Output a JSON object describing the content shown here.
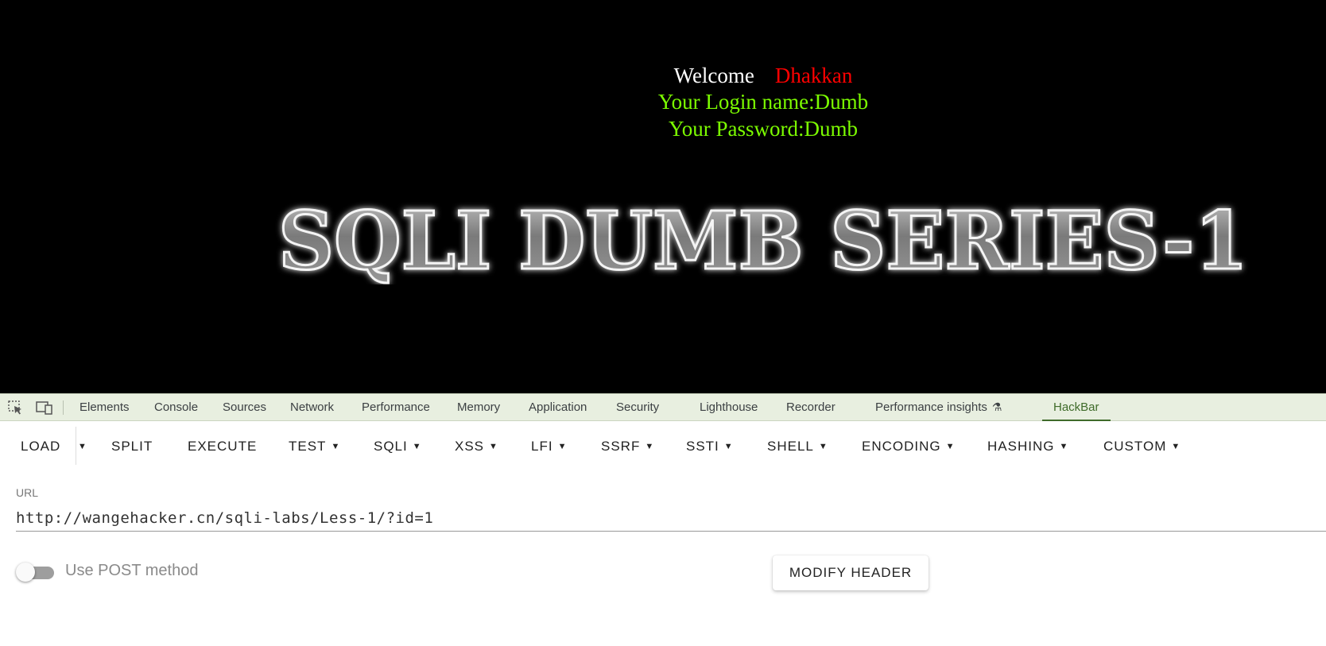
{
  "page": {
    "welcome_word": "Welcome",
    "welcome_user": "Dhakkan",
    "login_line": "Your Login name:Dumb",
    "password_line": "Your Password:Dumb",
    "banner_text": "SQLI DUMB SERIES-1",
    "colors": {
      "background": "#000000",
      "welcome": "#ffffff",
      "user": "#ff0000",
      "info": "#7cfc00"
    }
  },
  "devtools": {
    "icons": [
      "inspect-element-icon",
      "device-toolbar-icon"
    ],
    "tabs": [
      {
        "label": "Elements"
      },
      {
        "label": "Console"
      },
      {
        "label": "Sources"
      },
      {
        "label": "Network"
      },
      {
        "label": "Performance"
      },
      {
        "label": "Memory"
      },
      {
        "label": "Application"
      },
      {
        "label": "Security"
      },
      {
        "label": "Lighthouse"
      },
      {
        "label": "Recorder"
      },
      {
        "label": "Performance insights"
      },
      {
        "label": "HackBar"
      }
    ],
    "active_tab": "HackBar",
    "accent": "#3f6b2a"
  },
  "hackbar": {
    "buttons": [
      {
        "label": "LOAD"
      },
      {
        "label": "SPLIT"
      },
      {
        "label": "EXECUTE"
      },
      {
        "label": "TEST"
      },
      {
        "label": "SQLI"
      },
      {
        "label": "XSS"
      },
      {
        "label": "LFI"
      },
      {
        "label": "SSRF"
      },
      {
        "label": "SSTI"
      },
      {
        "label": "SHELL"
      },
      {
        "label": "ENCODING"
      },
      {
        "label": "HASHING"
      },
      {
        "label": "CUSTOM"
      }
    ],
    "url_label": "URL",
    "url_value": "http://wangehacker.cn/sqli-labs/Less-1/?id=1",
    "post_label": "Use POST method",
    "post_enabled": false,
    "modify_header_label": "MODIFY HEADER"
  }
}
